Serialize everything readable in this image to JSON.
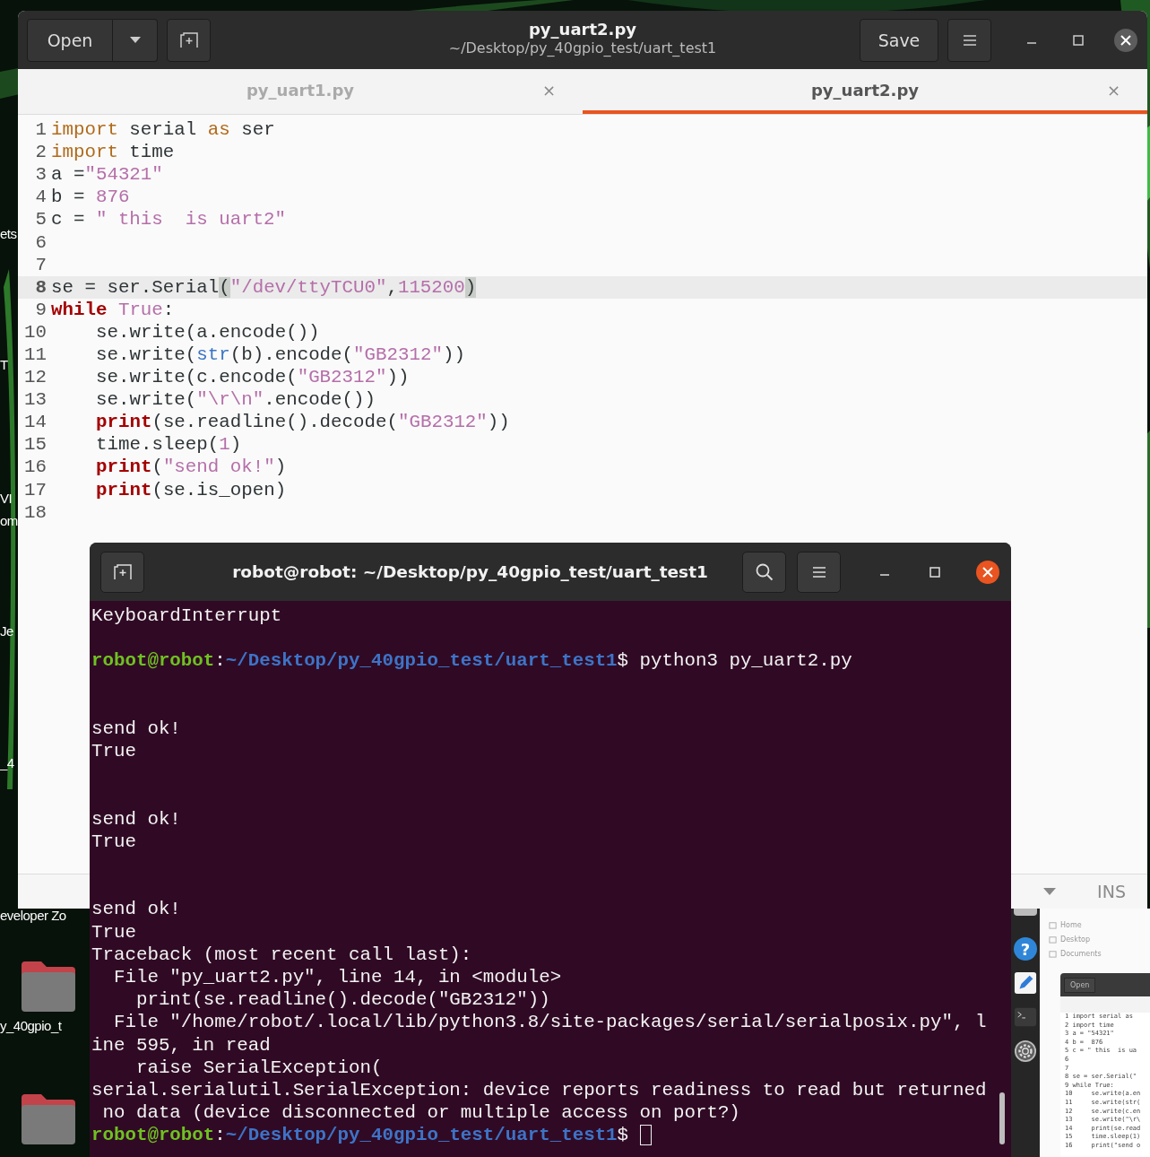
{
  "desktop": {
    "labels": [
      "ets",
      "T",
      "VI",
      "om",
      "Je",
      "_4",
      "eveloper Zo",
      "y_40gpio_t"
    ]
  },
  "editor": {
    "title": "py_uart2.py",
    "subtitle": "~/Desktop/py_40gpio_test/uart_test1",
    "open_button": "Open",
    "save_button": "Save",
    "tabs": [
      {
        "label": "py_uart1.py",
        "close": "×",
        "selected": false
      },
      {
        "label": "py_uart2.py",
        "close": "×",
        "selected": true
      }
    ],
    "lines": [
      {
        "num": "1",
        "current": false,
        "tokens": [
          {
            "kind": "keyword",
            "text": "import"
          },
          {
            "kind": "plain",
            "text": " serial "
          },
          {
            "kind": "keyword",
            "text": "as"
          },
          {
            "kind": "plain",
            "text": " ser"
          }
        ]
      },
      {
        "num": "2",
        "current": false,
        "tokens": [
          {
            "kind": "keyword",
            "text": "import"
          },
          {
            "kind": "plain",
            "text": " time"
          }
        ]
      },
      {
        "num": "3",
        "current": false,
        "tokens": [
          {
            "kind": "plain",
            "text": "a ="
          },
          {
            "kind": "string",
            "text": "\"54321\""
          }
        ]
      },
      {
        "num": "4",
        "current": false,
        "tokens": [
          {
            "kind": "plain",
            "text": "b = "
          },
          {
            "kind": "number",
            "text": "876"
          }
        ]
      },
      {
        "num": "5",
        "current": false,
        "tokens": [
          {
            "kind": "plain",
            "text": "c = "
          },
          {
            "kind": "string",
            "text": "\" this  is uart2\""
          }
        ]
      },
      {
        "num": "6",
        "current": false
      },
      {
        "num": "7",
        "current": false
      },
      {
        "num": "8",
        "current": true,
        "tokens": [
          {
            "kind": "plain",
            "text": "se = ser.Serial"
          },
          {
            "kind": "bracket",
            "text": "("
          },
          {
            "kind": "string",
            "text": "\"/dev/ttyTCU0\""
          },
          {
            "kind": "plain",
            "text": ","
          },
          {
            "kind": "number",
            "text": "115200"
          },
          {
            "kind": "bracket",
            "text": ")"
          }
        ]
      },
      {
        "num": "9",
        "current": false,
        "tokens": [
          {
            "kind": "control",
            "text": "while"
          },
          {
            "kind": "constant",
            "text": "True"
          },
          {
            "kind": "plain",
            "text": ":"
          }
        ],
        "children": [
          {
            "num": "10",
            "current": false,
            "tokens": [
              {
                "kind": "plain",
                "text": "se.write(a.encode())"
              }
            ]
          },
          {
            "num": "11",
            "current": false,
            "tokens": [
              {
                "kind": "plain",
                "text": "se.write("
              },
              {
                "kind": "builtin",
                "text": "str"
              },
              {
                "kind": "plain",
                "text": "(b).encode("
              },
              {
                "kind": "string",
                "text": "\"GB2312\""
              },
              {
                "kind": "plain",
                "text": "))"
              }
            ]
          },
          {
            "num": "12",
            "current": false,
            "tokens": [
              {
                "kind": "plain",
                "text": "se.write(c.encode("
              },
              {
                "kind": "string",
                "text": "\"GB2312\""
              },
              {
                "kind": "plain",
                "text": "))"
              }
            ]
          },
          {
            "num": "13",
            "current": false,
            "tokens": [
              {
                "kind": "plain",
                "text": "se.write("
              },
              {
                "kind": "string",
                "text": "\"\\r\\n\""
              },
              {
                "kind": "plain",
                "text": ".encode())"
              }
            ]
          },
          {
            "num": "14",
            "current": false,
            "tokens": [
              {
                "kind": "control",
                "text": "print"
              },
              {
                "kind": "plain",
                "text": "(se.readline().decode("
              },
              {
                "kind": "string",
                "text": "\"GB2312\""
              },
              {
                "kind": "plain",
                "text": "))"
              }
            ]
          },
          {
            "num": "15",
            "current": false,
            "tokens": [
              {
                "kind": "plain",
                "text": "time.sleep("
              },
              {
                "kind": "number",
                "text": "1"
              },
              {
                "kind": "plain",
                "text": ")"
              }
            ]
          },
          {
            "num": "16",
            "current": false,
            "tokens": [
              {
                "kind": "control",
                "text": "print"
              },
              {
                "kind": "plain",
                "text": "("
              },
              {
                "kind": "string",
                "text": "\"send ok!\""
              },
              {
                "kind": "plain",
                "text": ")"
              }
            ]
          },
          {
            "num": "17",
            "current": false,
            "tokens": [
              {
                "kind": "control",
                "text": "print"
              },
              {
                "kind": "plain",
                "text": "(se.is_open)"
              }
            ]
          }
        ]
      },
      {
        "num": "18",
        "current": false
      }
    ],
    "status_bar": {
      "mode": "INS"
    }
  },
  "terminal": {
    "title": "robot@robot: ~/Desktop/py_40gpio_test/uart_test1",
    "lines": [
      {
        "kind": "text",
        "text": "KeyboardInterrupt"
      },
      {
        "kind": "blank"
      },
      {
        "kind": "prompt",
        "user": "robot@robot",
        "colon": ":",
        "path": "~/Desktop/py_40gpio_test/uart_test1",
        "command": "$ python3 py_uart2.py",
        "cursor": false
      },
      {
        "kind": "blank"
      },
      {
        "kind": "blank"
      },
      {
        "kind": "text",
        "text": "send ok!"
      },
      {
        "kind": "text",
        "text": "True"
      },
      {
        "kind": "blank"
      },
      {
        "kind": "blank"
      },
      {
        "kind": "text",
        "text": "send ok!"
      },
      {
        "kind": "text",
        "text": "True"
      },
      {
        "kind": "blank"
      },
      {
        "kind": "blank"
      },
      {
        "kind": "text",
        "text": "send ok!"
      },
      {
        "kind": "text",
        "text": "True"
      },
      {
        "kind": "text",
        "text": "Traceback (most recent call last):"
      },
      {
        "kind": "text",
        "text": "  File \"py_uart2.py\", line 14, in <module>"
      },
      {
        "kind": "text",
        "text": "    print(se.readline().decode(\"GB2312\"))"
      },
      {
        "kind": "text",
        "text": "  File \"/home/robot/.local/lib/python3.8/site-packages/serial/serialposix.py\", l"
      },
      {
        "kind": "text",
        "text": "ine 595, in read"
      },
      {
        "kind": "text",
        "text": "    raise SerialException("
      },
      {
        "kind": "text",
        "text": "serial.serialutil.SerialException: device reports readiness to read but returned"
      },
      {
        "kind": "text",
        "text": " no data (device disconnected or multiple access on port?)"
      },
      {
        "kind": "prompt",
        "user": "robot@robot",
        "colon": ":",
        "path": "~/Desktop/py_40gpio_test/uart_test1",
        "command": "$",
        "cursor": true
      }
    ]
  },
  "dock": {
    "help_glyph": "?"
  },
  "files": {
    "places": [
      "Home",
      "Desktop",
      "Documents"
    ]
  },
  "thumbnail": {
    "open_button": "Open",
    "lines": [
      "1 import serial as",
      "2 import time",
      "3 a = \"54321\"",
      "4 b =  876",
      "5 c = \" this  is ua",
      "6",
      "7",
      "8 se = ser.Serial(\"",
      "9 while True:",
      "10     se.write(a.en",
      "11     se.write(str(",
      "12     se.write(c.en",
      "13     se.write(\"\\r\\",
      "14     print(se.read",
      "15     time.sleep(1)",
      "16     print(\"send o"
    ]
  }
}
